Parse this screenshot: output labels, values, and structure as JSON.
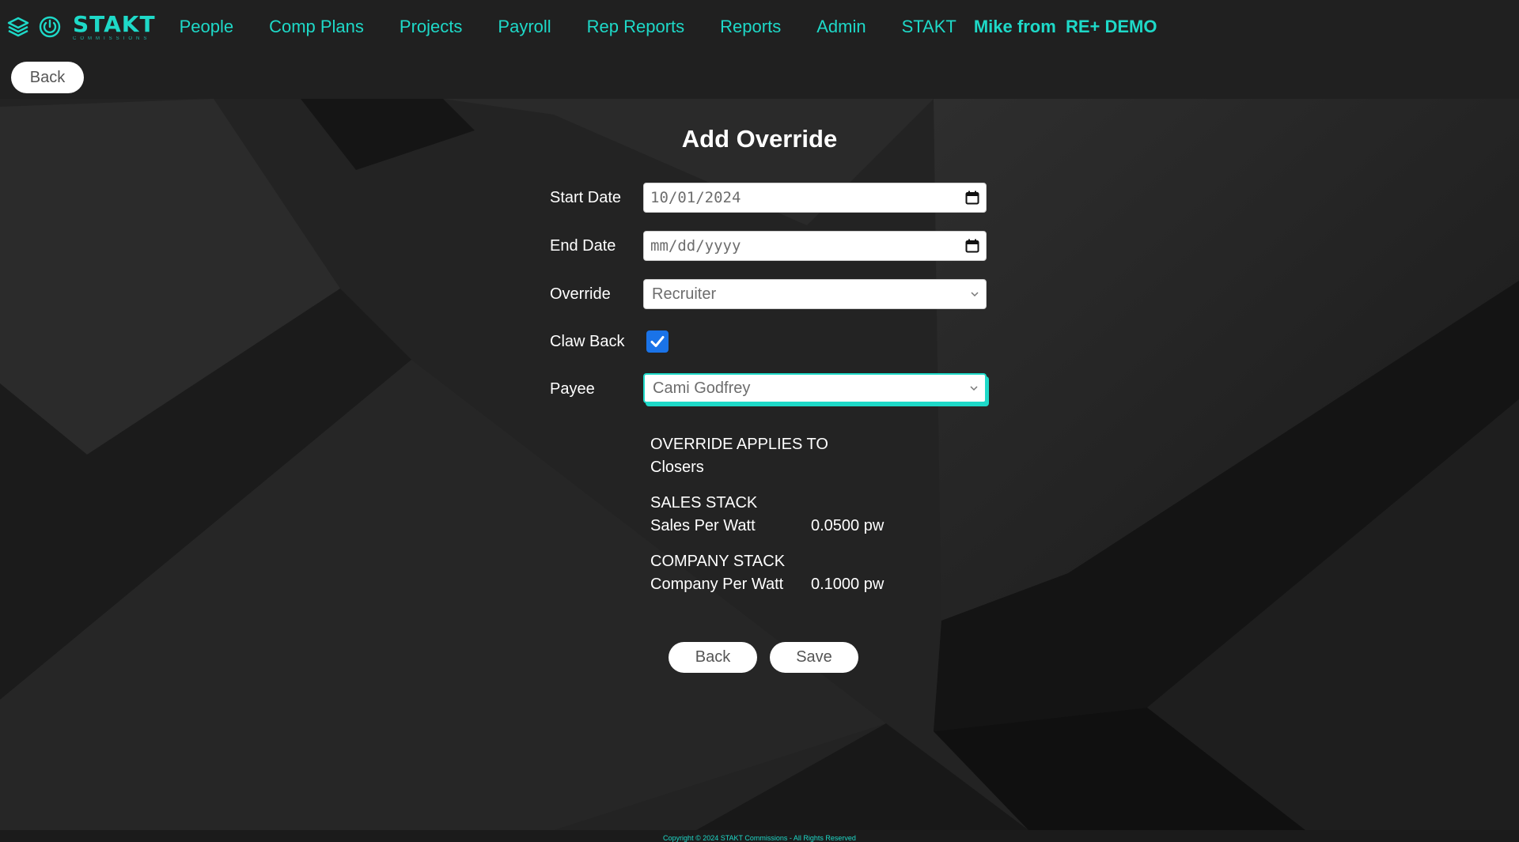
{
  "nav": {
    "brand_name": "STAKT",
    "brand_sub": "COMMISSIONS",
    "items": [
      "People",
      "Comp Plans",
      "Projects",
      "Payroll",
      "Rep Reports",
      "Reports",
      "Admin",
      "STAKT"
    ],
    "user": "Mike from  RE+ DEMO"
  },
  "top_back_label": "Back",
  "form": {
    "title": "Add Override",
    "start_date_label": "Start Date",
    "start_date_value": "10/01/2024",
    "end_date_label": "End Date",
    "end_date_placeholder": "mm/dd/yyyy",
    "override_label": "Override",
    "override_value": "Recruiter",
    "claw_back_label": "Claw Back",
    "claw_back_checked": true,
    "payee_label": "Payee",
    "payee_value": "Cami Godfrey"
  },
  "info": {
    "applies_heading": "OVERRIDE APPLIES TO",
    "applies_value": "Closers",
    "sales_heading": "SALES STACK",
    "sales_label": "Sales Per Watt",
    "sales_value": "0.0500 pw",
    "company_heading": "COMPANY STACK",
    "company_label": "Company Per Watt",
    "company_value": "0.1000 pw"
  },
  "buttons": {
    "back": "Back",
    "save": "Save"
  },
  "footer": "Copyright © 2024 STAKT Commissions - All Rights Reserved",
  "colors": {
    "accent": "#1ed9c8",
    "checkbox": "#1a73e8",
    "background": "#202020"
  }
}
